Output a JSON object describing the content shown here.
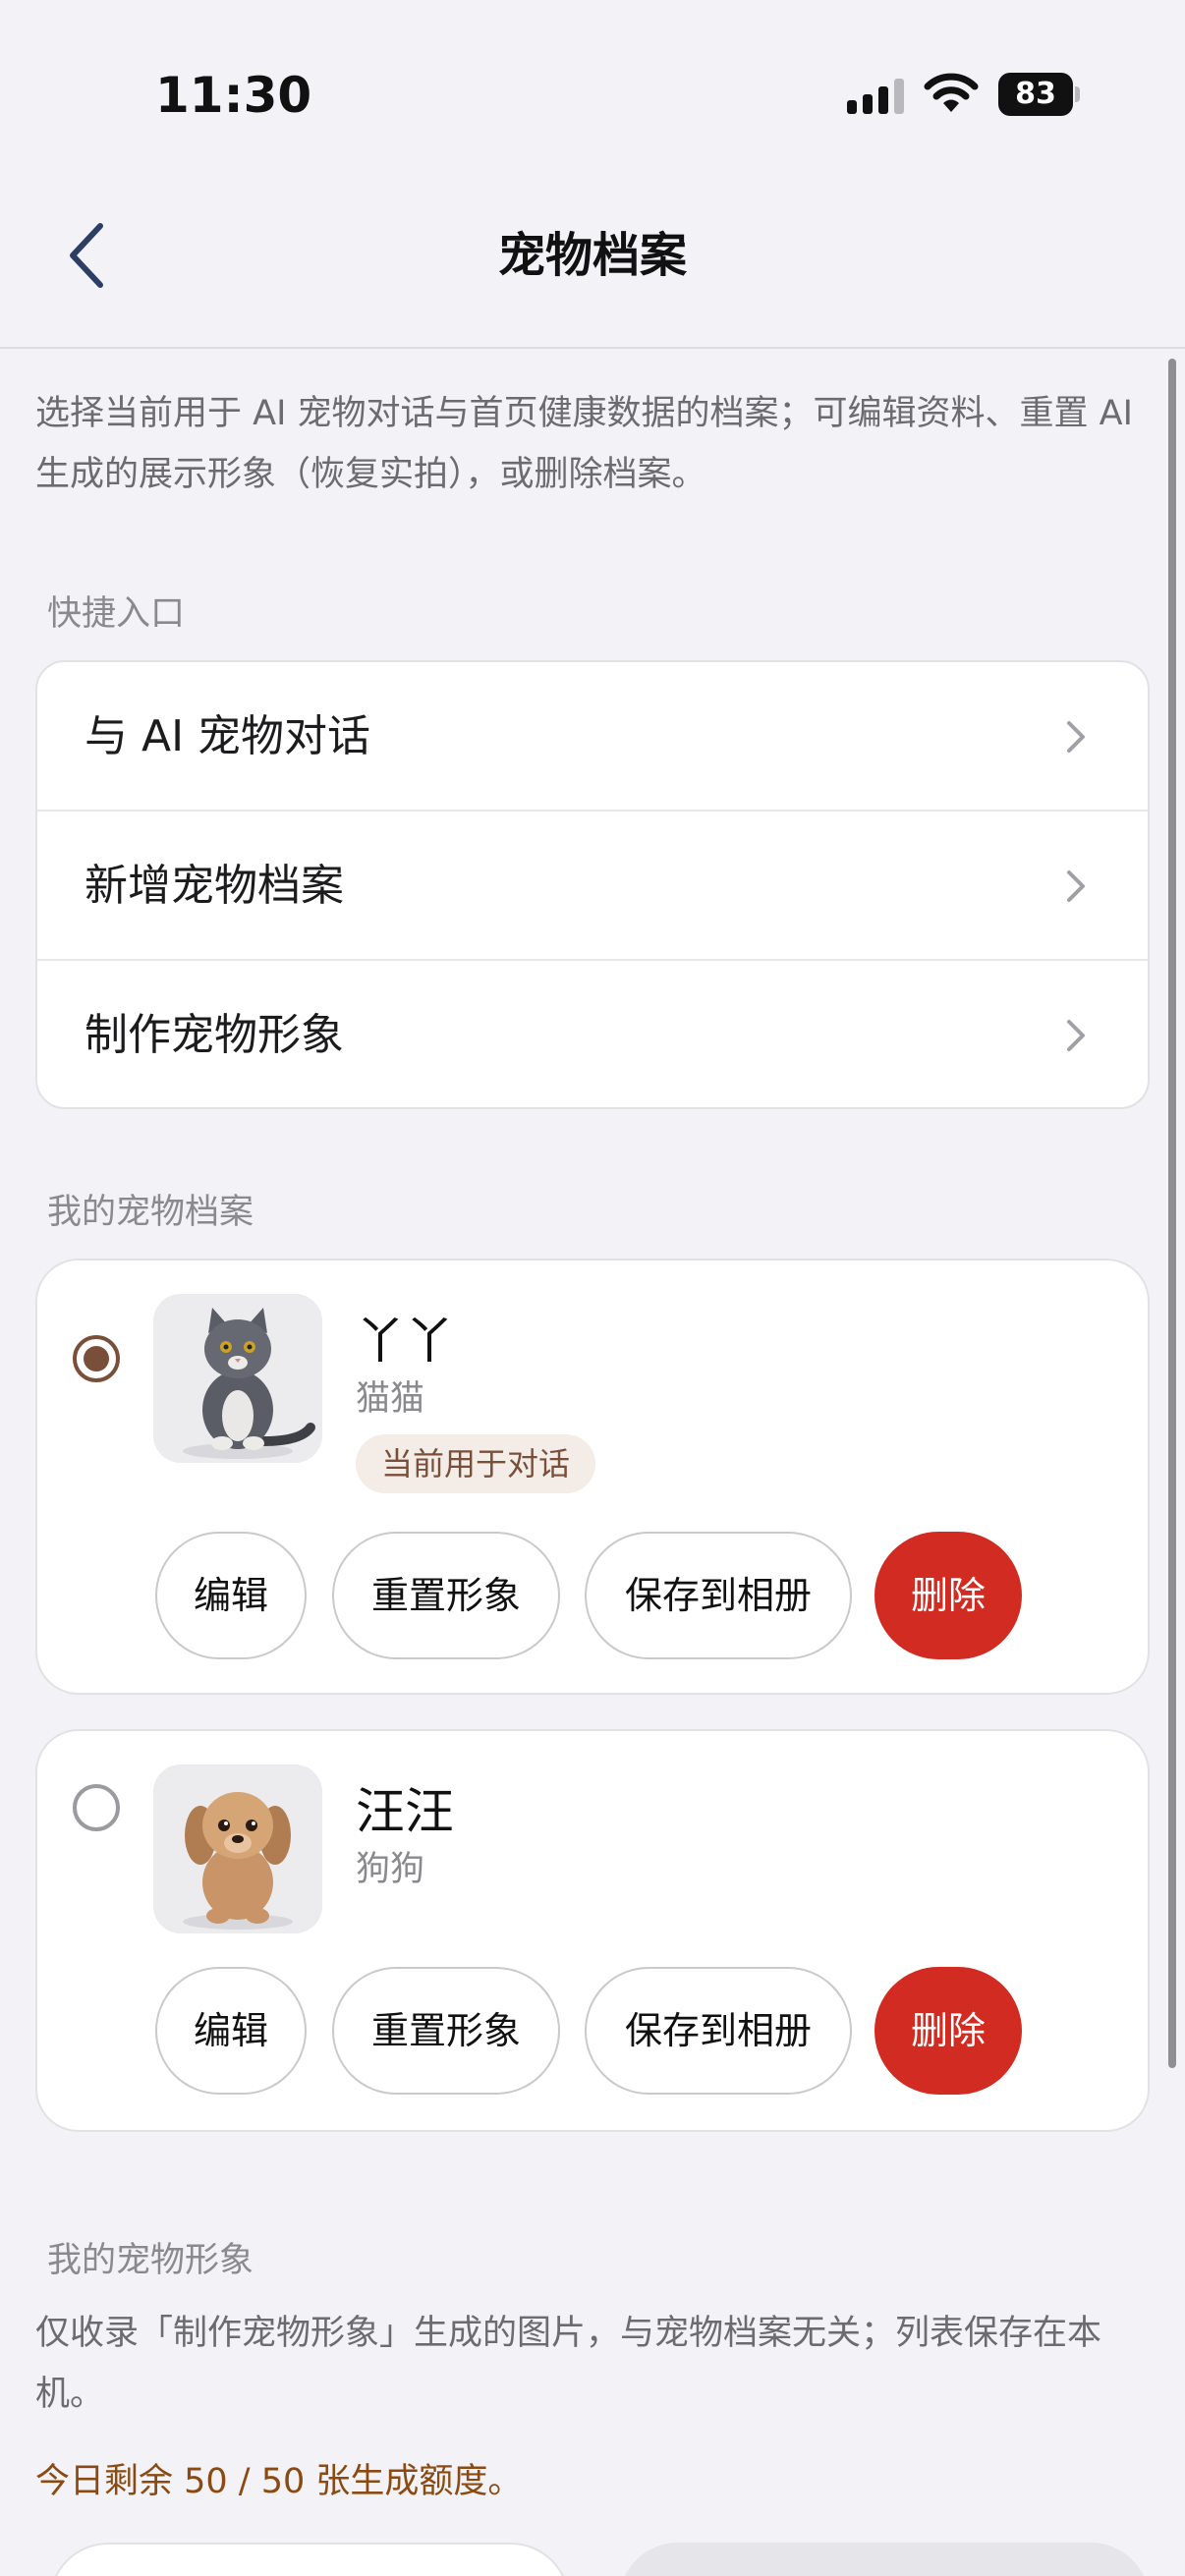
{
  "status_bar": {
    "time": "11:30",
    "battery": "83"
  },
  "nav": {
    "title": "宠物档案"
  },
  "intro": "选择当前用于 AI 宠物对话与首页健康数据的档案；可编辑资料、重置 AI 生成的展示形象（恢复实拍），或删除档案。",
  "shortcuts": {
    "label": "快捷入口",
    "items": [
      {
        "label": "与 AI 宠物对话"
      },
      {
        "label": "新增宠物档案"
      },
      {
        "label": "制作宠物形象"
      }
    ]
  },
  "pets": {
    "label": "我的宠物档案",
    "items": [
      {
        "name": "丫丫",
        "species": "猫猫",
        "badge": "当前用于对话",
        "selected": true,
        "actions": {
          "edit": "编辑",
          "reset": "重置形象",
          "save": "保存到相册",
          "delete": "删除"
        }
      },
      {
        "name": "汪汪",
        "species": "狗狗",
        "selected": false,
        "actions": {
          "edit": "编辑",
          "reset": "重置形象",
          "save": "保存到相册",
          "delete": "删除"
        }
      }
    ]
  },
  "gallery": {
    "label": "我的宠物形象",
    "note": "仅收录「制作宠物形象」生成的图片，与宠物档案无关；列表保存在本机。",
    "quota": "今日剩余 50 / 50 张生成额度。"
  },
  "colors": {
    "accent": "#7a4f3a",
    "danger": "#d22b22",
    "quota": "#8a4a12",
    "background": "#f2f2f7"
  }
}
